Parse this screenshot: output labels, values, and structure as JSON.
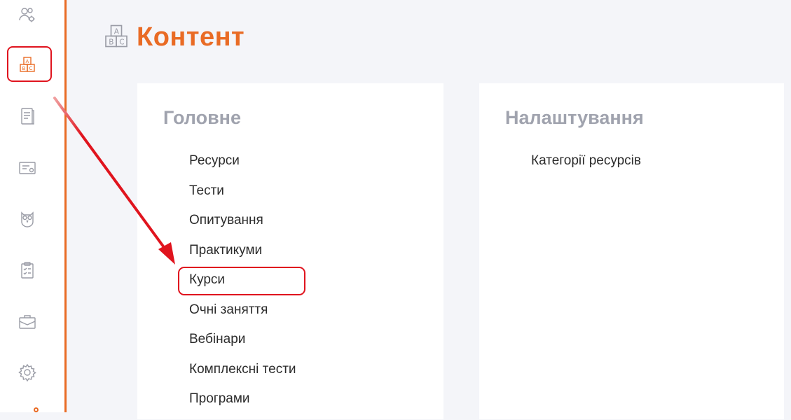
{
  "page": {
    "title": "Контент",
    "title_icon": "abc-blocks-icon"
  },
  "sidebar": {
    "accent_color": "#e96b25",
    "items": [
      {
        "name": "users-settings-icon"
      },
      {
        "name": "abc-blocks-icon",
        "active": true
      },
      {
        "name": "notebook-icon"
      },
      {
        "name": "certificate-icon"
      },
      {
        "name": "owl-icon"
      },
      {
        "name": "clipboard-checklist-icon"
      },
      {
        "name": "briefcase-icon"
      },
      {
        "name": "gear-icon"
      }
    ]
  },
  "main_card": {
    "title": "Головне",
    "items": [
      {
        "label": "Ресурси"
      },
      {
        "label": "Тести"
      },
      {
        "label": "Опитування"
      },
      {
        "label": "Практикуми"
      },
      {
        "label": "Курси",
        "highlighted": true
      },
      {
        "label": "Очні заняття"
      },
      {
        "label": "Вебінари"
      },
      {
        "label": "Комплексні тести"
      },
      {
        "label": "Програми"
      }
    ]
  },
  "settings_card": {
    "title": "Налаштування",
    "items": [
      {
        "label": "Категорії ресурсів"
      }
    ]
  },
  "annotation": {
    "color": "#e0141e",
    "arrow": "from-sidebar-content-icon-to-courses-item"
  }
}
